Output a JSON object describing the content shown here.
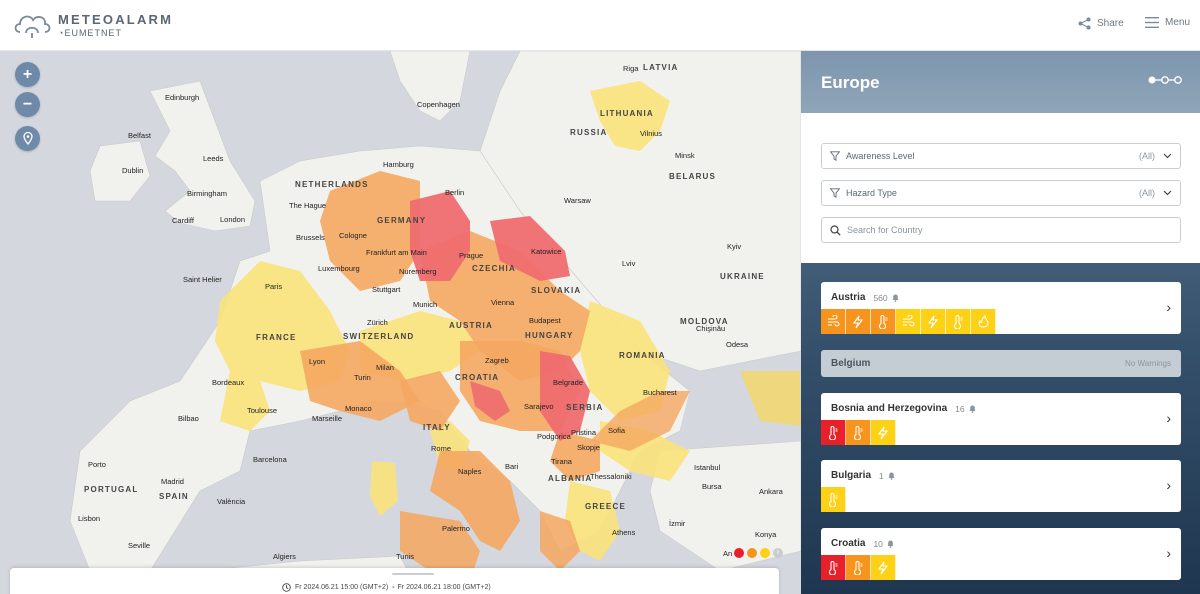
{
  "header": {
    "logo_title": "METEOALARM",
    "logo_sub": "EUMETNET",
    "share_label": "Share",
    "menu_label": "Menu"
  },
  "map": {
    "countries": [
      {
        "label": "LATVIA"
      },
      {
        "label": "LITHUANIA"
      },
      {
        "label": "RUSSIA"
      },
      {
        "label": "BELARUS"
      },
      {
        "label": "NETHERLANDS"
      },
      {
        "label": "GERMANY"
      },
      {
        "label": "CZECHIA"
      },
      {
        "label": "SLOVAKIA"
      },
      {
        "label": "AUSTRIA"
      },
      {
        "label": "HUNGARY"
      },
      {
        "label": "SWITZERLAND"
      },
      {
        "label": "FRANCE"
      },
      {
        "label": "UKRAINE"
      },
      {
        "label": "MOLDOVA"
      },
      {
        "label": "ROMANIA"
      },
      {
        "label": "CROATIA"
      },
      {
        "label": "SERBIA"
      },
      {
        "label": "ITALY"
      },
      {
        "label": "ALBANIA"
      },
      {
        "label": "GREECE"
      },
      {
        "label": "PORTUGAL"
      },
      {
        "label": "SPAIN"
      }
    ],
    "cities": [
      {
        "label": "Riga"
      },
      {
        "label": "Edinburgh"
      },
      {
        "label": "Copenhagen"
      },
      {
        "label": "Vilnius"
      },
      {
        "label": "Belfast"
      },
      {
        "label": "Minsk"
      },
      {
        "label": "Dublin"
      },
      {
        "label": "Leeds"
      },
      {
        "label": "Hamburg"
      },
      {
        "label": "Birmingham"
      },
      {
        "label": "Berlin"
      },
      {
        "label": "Cardiff"
      },
      {
        "label": "London"
      },
      {
        "label": "The Hague"
      },
      {
        "label": "Warsaw"
      },
      {
        "label": "Brussels"
      },
      {
        "label": "Cologne"
      },
      {
        "label": "Frankfurt am Main"
      },
      {
        "label": "Katowice"
      },
      {
        "label": "Kyiv"
      },
      {
        "label": "Saint Helier"
      },
      {
        "label": "Luxembourg"
      },
      {
        "label": "Prague"
      },
      {
        "label": "Lviv"
      },
      {
        "label": "Paris"
      },
      {
        "label": "Stuttgart"
      },
      {
        "label": "Nuremberg"
      },
      {
        "label": "Munich"
      },
      {
        "label": "Vienna"
      },
      {
        "label": "Zürich"
      },
      {
        "label": "Budapest"
      },
      {
        "label": "Chişinău"
      },
      {
        "label": "Odesa"
      },
      {
        "label": "Lyon"
      },
      {
        "label": "Milan"
      },
      {
        "label": "Zagreb"
      },
      {
        "label": "Bordeaux"
      },
      {
        "label": "Turin"
      },
      {
        "label": "Belgrade"
      },
      {
        "label": "Bucharest"
      },
      {
        "label": "Toulouse"
      },
      {
        "label": "Monaco"
      },
      {
        "label": "Marseille"
      },
      {
        "label": "Sarajevo"
      },
      {
        "label": "Bilbao"
      },
      {
        "label": "Podgorica"
      },
      {
        "label": "Pristina"
      },
      {
        "label": "Sofia"
      },
      {
        "label": "Porto"
      },
      {
        "label": "Barcelona"
      },
      {
        "label": "Rome"
      },
      {
        "label": "Skopje"
      },
      {
        "label": "Tirana"
      },
      {
        "label": "Istanbul"
      },
      {
        "label": "Naples"
      },
      {
        "label": "Bari"
      },
      {
        "label": "Thessaloniki"
      },
      {
        "label": "Madrid"
      },
      {
        "label": "Bursa"
      },
      {
        "label": "Ankara"
      },
      {
        "label": "València"
      },
      {
        "label": "Lisbon"
      },
      {
        "label": "İzmir"
      },
      {
        "label": "Palermo"
      },
      {
        "label": "Seville"
      },
      {
        "label": "Athens"
      },
      {
        "label": "Konya"
      },
      {
        "label": "Algiers"
      },
      {
        "label": "Tunis"
      },
      {
        "label": "An"
      }
    ],
    "legend_colors": [
      "#e8202a",
      "#f7941d",
      "#fcd116"
    ],
    "info_icon": "info-icon"
  },
  "timebar": {
    "from": "Fr 2024.06.21 15:00 (GMT+2)",
    "sep": "-",
    "to": "Fr 2024.06.21 18:00 (GMT+2)"
  },
  "panel": {
    "title": "Europe",
    "filters": {
      "awareness_label": "Awareness Level",
      "awareness_value": "(All)",
      "hazard_label": "Hazard Type",
      "hazard_value": "(All)",
      "search_placeholder": "Search for Country"
    },
    "countries": [
      {
        "name": "Austria",
        "count": "560",
        "icons": [
          {
            "icon": "wind-icon",
            "color": "#f7941d"
          },
          {
            "icon": "thunderstorm-icon",
            "color": "#f7941d"
          },
          {
            "icon": "high-temperature-icon",
            "color": "#f7941d"
          },
          {
            "icon": "wind-icon",
            "color": "#fcd116"
          },
          {
            "icon": "thunderstorm-icon",
            "color": "#fcd116"
          },
          {
            "icon": "high-temperature-icon",
            "color": "#fcd116"
          },
          {
            "icon": "forest-fire-icon",
            "color": "#fcd116"
          }
        ]
      },
      {
        "name": "Belgium",
        "no_warnings": "No Warnings"
      },
      {
        "name": "Bosnia and Herzegovina",
        "count": "16",
        "icons": [
          {
            "icon": "high-temperature-icon",
            "color": "#e8202a"
          },
          {
            "icon": "high-temperature-icon",
            "color": "#f7941d"
          },
          {
            "icon": "thunderstorm-icon",
            "color": "#fcd116"
          }
        ]
      },
      {
        "name": "Bulgaria",
        "count": "1",
        "icons": [
          {
            "icon": "high-temperature-icon",
            "color": "#fcd116"
          }
        ]
      },
      {
        "name": "Croatia",
        "count": "10",
        "icons": [
          {
            "icon": "high-temperature-icon",
            "color": "#e8202a"
          },
          {
            "icon": "high-temperature-icon",
            "color": "#f7941d"
          },
          {
            "icon": "thunderstorm-icon",
            "color": "#fcd116"
          }
        ]
      }
    ]
  }
}
